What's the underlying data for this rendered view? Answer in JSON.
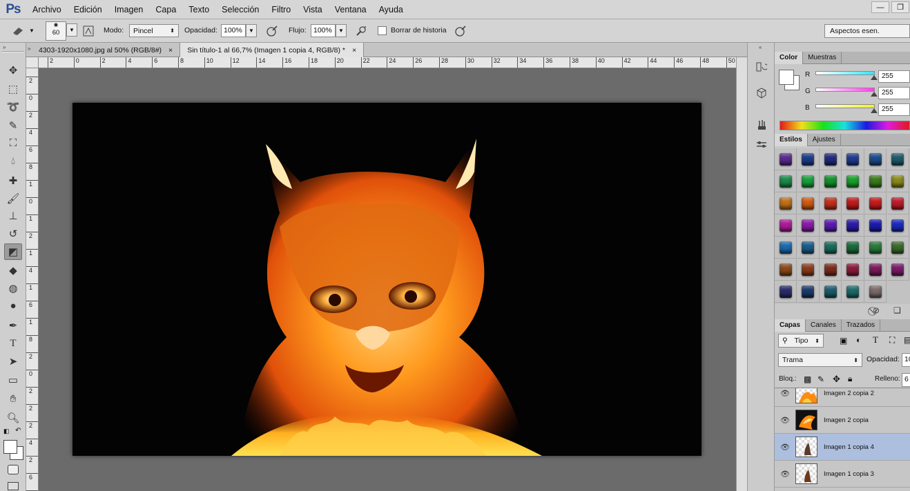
{
  "app": {
    "logo": "Ps",
    "menus": [
      "Archivo",
      "Edición",
      "Imagen",
      "Capa",
      "Texto",
      "Selección",
      "Filtro",
      "Vista",
      "Ventana",
      "Ayuda"
    ]
  },
  "window_controls": [
    {
      "name": "minimize-icon",
      "glyph": "—"
    },
    {
      "name": "restore-icon",
      "glyph": "❐"
    }
  ],
  "options": {
    "brush_size": "60",
    "mode_label": "Modo:",
    "mode_value": "Pincel",
    "opacity_label": "Opacidad:",
    "opacity_value": "100%",
    "flow_label": "Flujo:",
    "flow_value": "100%",
    "erase_history_label": "Borrar de historia",
    "workspace": "Aspectos esen."
  },
  "tabs": [
    {
      "label": "4303-1920x1080.jpg al 50% (RGB/8#)",
      "close": "×",
      "active": false
    },
    {
      "label": "Sin título-1 al 66,7% (Imagen 1 copia 4, RGB/8) *",
      "close": "×",
      "active": true
    }
  ],
  "rulers": {
    "h": [
      "2",
      "0",
      "2",
      "4",
      "6",
      "8",
      "10",
      "12",
      "14",
      "16",
      "18",
      "20",
      "22",
      "24",
      "26",
      "28",
      "30",
      "32",
      "34",
      "36",
      "38",
      "40",
      "42",
      "44",
      "46",
      "48",
      "50"
    ],
    "v": [
      "2",
      "0",
      "2",
      "4",
      "6",
      "8",
      "1",
      "0",
      "1",
      "2",
      "1",
      "4",
      "1",
      "6",
      "1",
      "8",
      "2",
      "0",
      "2",
      "2",
      "2",
      "4",
      "2",
      "6",
      "2",
      "8"
    ]
  },
  "color_panel": {
    "tabs": [
      "Color",
      "Muestras"
    ],
    "channels": [
      {
        "label": "R",
        "value": "255",
        "color": "#30e8ff"
      },
      {
        "label": "G",
        "value": "255",
        "color": "#ff3cf0"
      },
      {
        "label": "B",
        "value": "255",
        "color": "#f2f21e"
      }
    ]
  },
  "styles_panel": {
    "tabs": [
      "Estilos",
      "Ajustes"
    ],
    "swatches": [
      "#5a2a8f",
      "#1c3a8a",
      "#202a7a",
      "#1e3a90",
      "#1a4a8c",
      "#1e5a6a",
      "#1a8a4a",
      "#16a03a",
      "#12902a",
      "#1aa02a",
      "#3a7a1a",
      "#8a8a1a",
      "#c07018",
      "#d05a10",
      "#c0301a",
      "#c01a1a",
      "#c81a1a",
      "#c01a2a",
      "#b01a9a",
      "#8a1aa8",
      "#5a1ab0",
      "#2a1aa8",
      "#1a1ab0",
      "#1a2ac0",
      "#1a6ab0",
      "#1a5a8a",
      "#1a6a5a",
      "#1a6a3a",
      "#2a7a3a",
      "#3a6a2a",
      "#8a4a1a",
      "#8a3a1a",
      "#7a2a1a",
      "#8a1a3a",
      "#7a1a5a",
      "#7a1a6a",
      "#2a2a6a",
      "#1a3a6a",
      "#1a5a6a",
      "#1a6a6a",
      "#7a6a6a"
    ]
  },
  "layers_panel": {
    "tabs": [
      "Capas",
      "Canales",
      "Trazados"
    ],
    "filter_label": "Tipo",
    "blend_mode": "Trama",
    "opacity_label": "Opacidad:",
    "opacity_value": "10",
    "lock_label": "Bloq.:",
    "fill_label": "Relleno:",
    "fill_value": "6",
    "layers": [
      {
        "name": "Imagen 2 copia 2",
        "active": false
      },
      {
        "name": "Imagen 2 copia",
        "active": false
      },
      {
        "name": "Imagen 1 copia 4",
        "active": true
      },
      {
        "name": "Imagen 1 copia 3",
        "active": false
      }
    ]
  }
}
